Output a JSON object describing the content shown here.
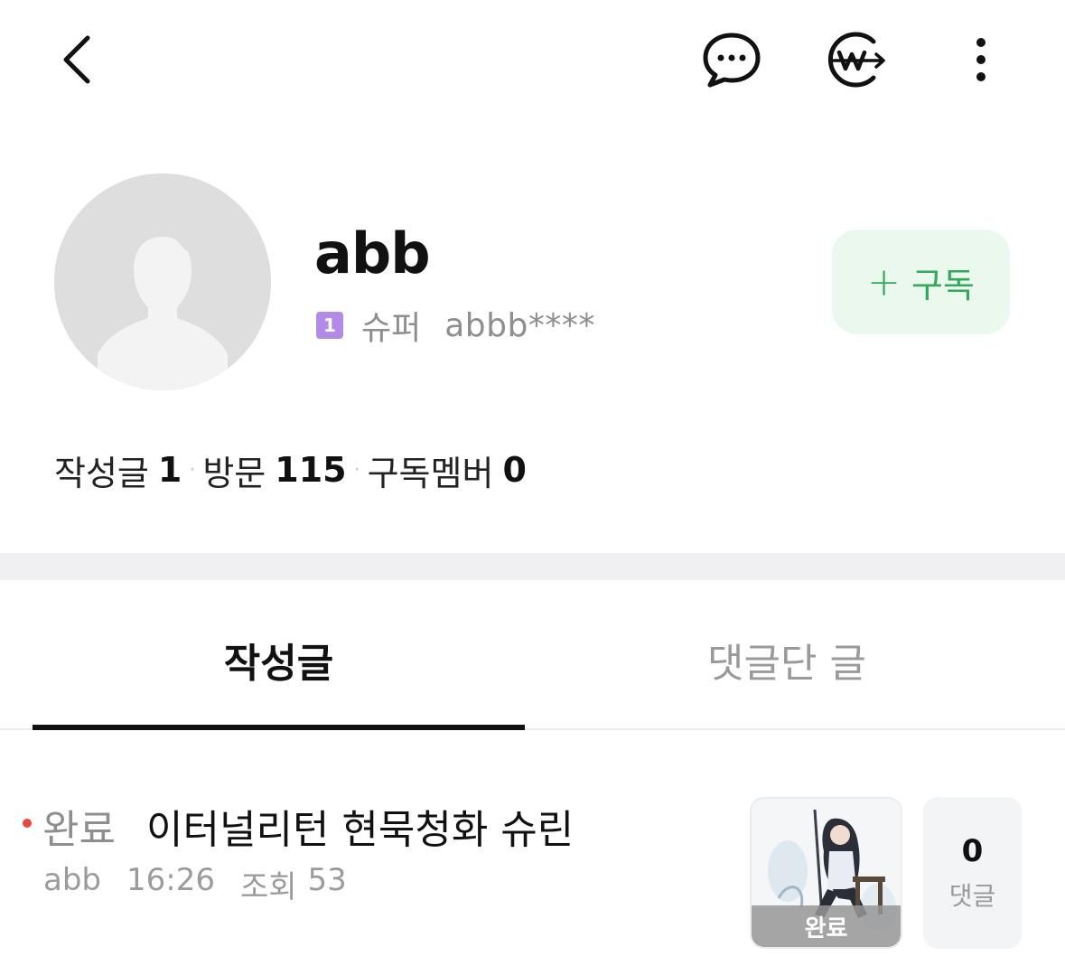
{
  "topbar": {
    "icons": [
      "back-icon",
      "chat-bubble-icon",
      "w-share-icon",
      "more-vertical-icon"
    ]
  },
  "profile": {
    "nickname": "abb",
    "level_badge": "1",
    "level_name": "슈퍼",
    "user_id": "abbb****",
    "avatar": "default-avatar-icon"
  },
  "subscribe": {
    "plus": "+",
    "label": "구독"
  },
  "stats": {
    "posts_label": "작성글",
    "posts_value": "1",
    "visits_label": "방문",
    "visits_value": "115",
    "subscribers_label": "구독멤버",
    "subscribers_value": "0",
    "separator": "·"
  },
  "tabs": [
    {
      "label": "작성글",
      "active": true
    },
    {
      "label": "댓글단 글",
      "active": false
    }
  ],
  "posts": [
    {
      "status": "완료",
      "title": "이터널리턴 현묵청화 슈린",
      "author": "abb",
      "time": "16:26",
      "views_label": "조회",
      "views": "53",
      "thumb_badge": "완료",
      "comment_count": "0",
      "comment_label": "댓글"
    }
  ],
  "colors": {
    "accent_green": "#32a85c",
    "subscribe_bg": "#eaf8ee",
    "level_badge": "#b28ae8",
    "new_dot": "#e8483c"
  }
}
